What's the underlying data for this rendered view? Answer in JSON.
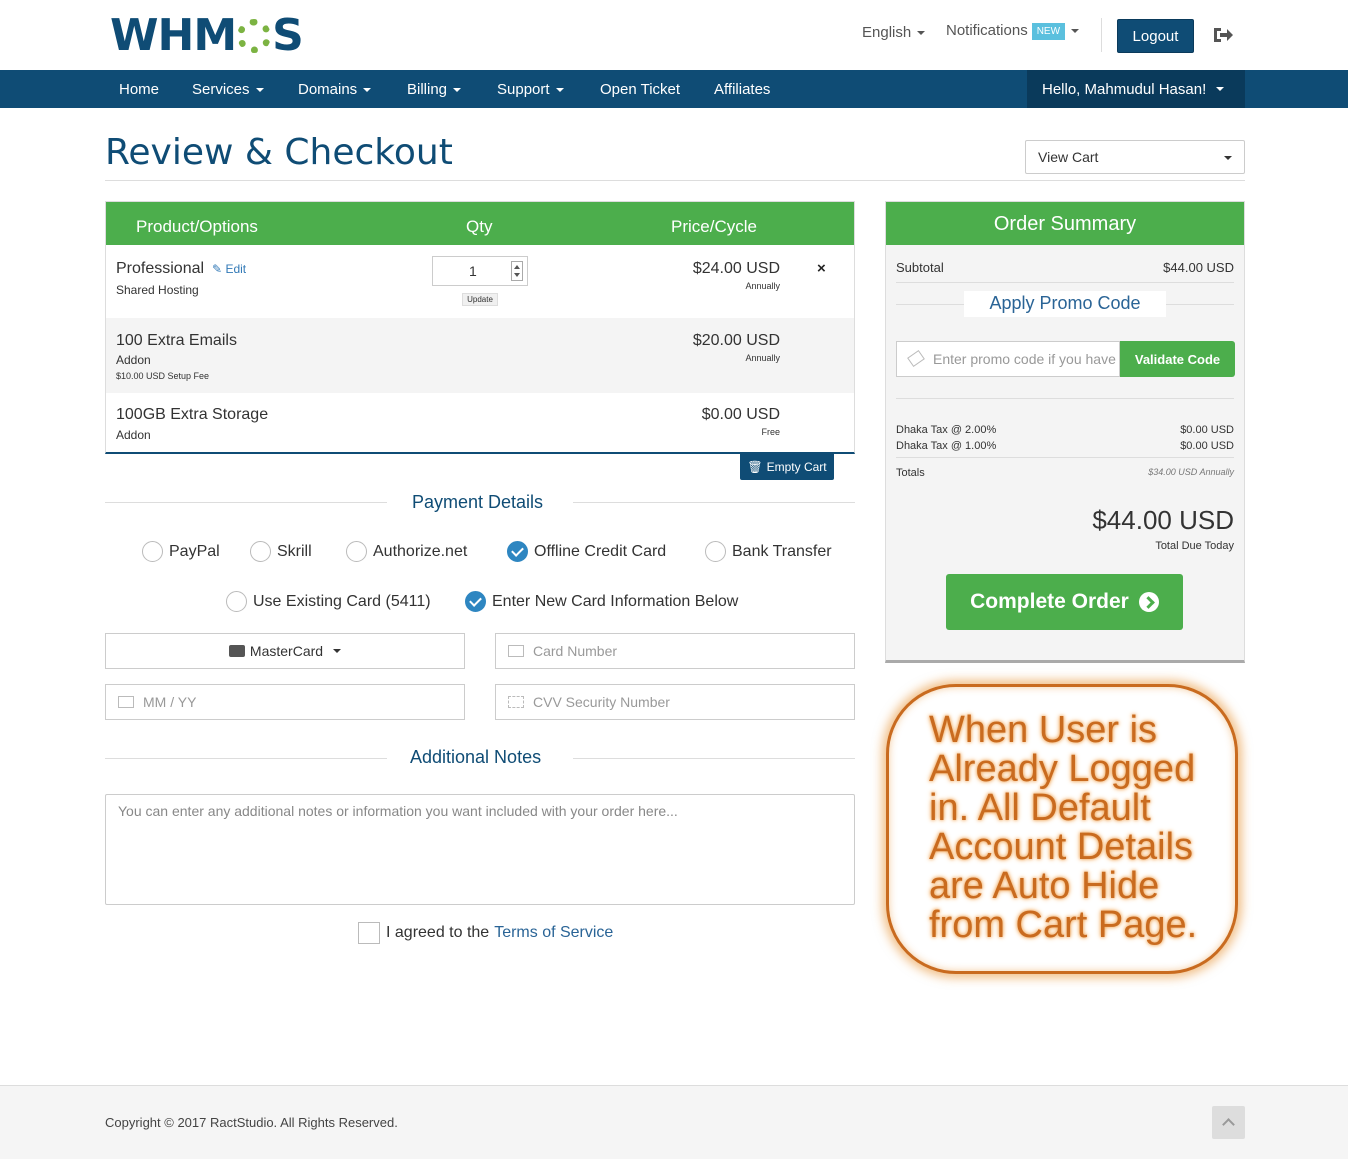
{
  "header": {
    "logo_text": "WHMCS",
    "language": "English",
    "notifications": "Notifications",
    "new_badge": "NEW",
    "logout": "Logout"
  },
  "nav": {
    "items": [
      {
        "label": "Home"
      },
      {
        "label": "Services"
      },
      {
        "label": "Domains"
      },
      {
        "label": "Billing"
      },
      {
        "label": "Support"
      },
      {
        "label": "Open Ticket"
      },
      {
        "label": "Affiliates"
      }
    ],
    "user": "Hello, Mahmudul Hasan!"
  },
  "page": {
    "title": "Review & Checkout",
    "view_cart": "View Cart"
  },
  "cart": {
    "columns": [
      "Product/Options",
      "Qty",
      "Price/Cycle"
    ],
    "items": [
      {
        "name": "Professional",
        "edit": "Edit",
        "sub": "Shared Hosting",
        "qty": "1",
        "update": "Update",
        "price": "$24.00 USD",
        "cycle": "Annually",
        "remove": "×"
      },
      {
        "name": "100 Extra Emails",
        "sub": "Addon",
        "setup": "$10.00 USD Setup Fee",
        "price": "$20.00 USD",
        "cycle": "Annually"
      },
      {
        "name": "100GB Extra Storage",
        "sub": "Addon",
        "price": "$0.00 USD",
        "cycle": "Free"
      }
    ],
    "empty_cart": "Empty Cart"
  },
  "payment": {
    "title": "Payment Details",
    "gateways": [
      {
        "label": "PayPal",
        "checked": false
      },
      {
        "label": "Skrill",
        "checked": false
      },
      {
        "label": "Authorize.net",
        "checked": false
      },
      {
        "label": "Offline Credit Card",
        "checked": true
      },
      {
        "label": "Bank Transfer",
        "checked": false
      }
    ],
    "card_options": [
      {
        "label": "Use Existing Card (5411)",
        "checked": false
      },
      {
        "label": "Enter New Card Information Below",
        "checked": true
      }
    ],
    "card_type": "MasterCard",
    "card_number_placeholder": "Card Number",
    "expiry_placeholder": "MM / YY",
    "cvv_placeholder": "CVV Security Number"
  },
  "notes": {
    "title": "Additional Notes",
    "placeholder": "You can enter any additional notes or information you want included with your order here..."
  },
  "tos": {
    "prefix": "I agreed to the",
    "link": "Terms of Service"
  },
  "summary": {
    "title": "Order Summary",
    "subtotal_label": "Subtotal",
    "subtotal_value": "$44.00 USD",
    "promo_title": "Apply Promo Code",
    "promo_placeholder": "Enter promo code if you have one",
    "validate": "Validate Code",
    "taxes": [
      {
        "label": "Dhaka Tax @ 2.00%",
        "value": "$0.00 USD"
      },
      {
        "label": "Dhaka Tax @ 1.00%",
        "value": "$0.00 USD"
      }
    ],
    "totals_label": "Totals",
    "totals_value": "$34.00 USD Annually",
    "total_due": "$44.00 USD",
    "total_due_label": "Total Due Today",
    "complete": "Complete Order"
  },
  "annotation": {
    "text": "When User is Already Logged in. All Default Account Details are Auto Hide from Cart Page."
  },
  "footer": {
    "copyright": "Copyright © 2017 RactStudio. All Rights Reserved."
  }
}
